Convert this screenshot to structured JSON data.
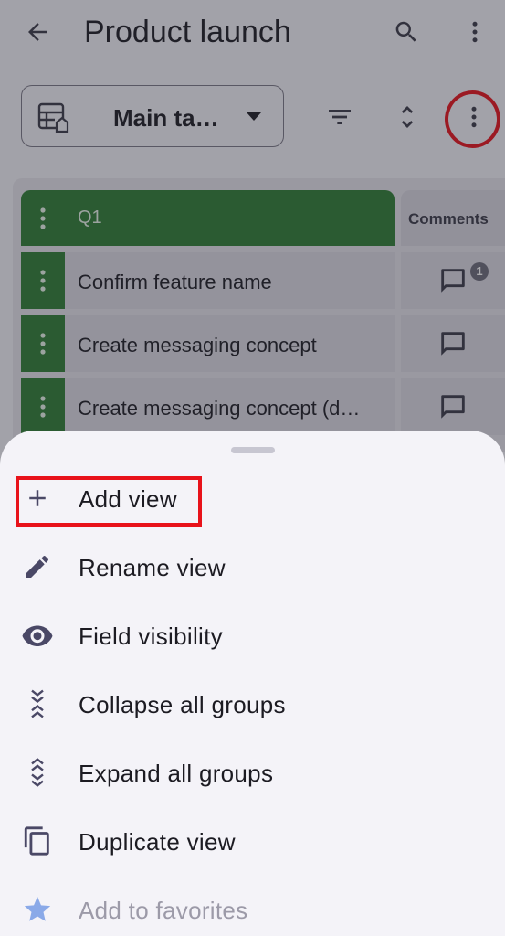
{
  "app": {
    "title": "Product launch",
    "view_name": "Main ta…",
    "icons": {
      "back": "arrow-left-icon",
      "search": "search-icon",
      "more": "more-vertical-icon",
      "view": "table-view-icon",
      "filter": "filter-icon",
      "sort": "unfold-icon"
    }
  },
  "table": {
    "group_name": "Q1",
    "comments_header": "Comments",
    "rows": [
      {
        "text": "Confirm feature name",
        "comment_count": "1"
      },
      {
        "text": "Create messaging concept",
        "comment_count": ""
      },
      {
        "text": "Create messaging concept (d…",
        "comment_count": ""
      }
    ]
  },
  "menu": {
    "items": [
      {
        "label": "Add view",
        "icon": "plus-icon"
      },
      {
        "label": "Rename view",
        "icon": "pencil-icon"
      },
      {
        "label": "Field visibility",
        "icon": "eye-icon"
      },
      {
        "label": "Collapse all groups",
        "icon": "collapse-icon"
      },
      {
        "label": "Expand all groups",
        "icon": "expand-icon"
      },
      {
        "label": "Duplicate view",
        "icon": "copy-icon"
      },
      {
        "label": "Add to favorites",
        "icon": "star-icon",
        "disabled": true
      }
    ]
  },
  "colors": {
    "group_green": "#2e7d32",
    "annotation_red": "#e8121a",
    "icon_color": "#4a4866",
    "star_disabled": "#8aa9e8"
  }
}
